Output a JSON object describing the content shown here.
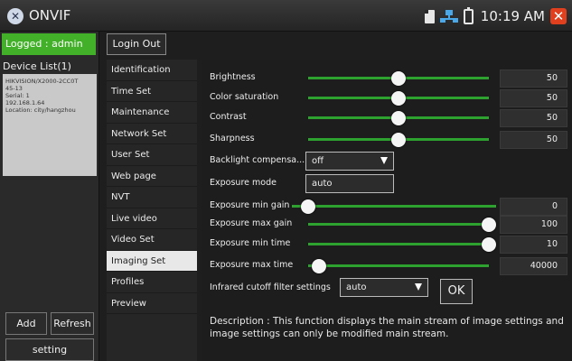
{
  "titlebar": {
    "app_name": "ONVIF",
    "time": "10:19 AM"
  },
  "left": {
    "logged": "Logged : admin",
    "device_list_title": "Device List(1)",
    "device": {
      "name": "HIKVISION/X2000-2CC0T",
      "line2": "45-13",
      "serial": "Serial: 1",
      "ip": "192.168.1.64",
      "location": "Location: city/hangzhou"
    },
    "add": "Add",
    "refresh": "Refresh",
    "setting": "setting"
  },
  "login_out": "Login Out",
  "menu": {
    "items": [
      {
        "label": "Identification",
        "active": false
      },
      {
        "label": "Time Set",
        "active": false
      },
      {
        "label": "Maintenance",
        "active": false
      },
      {
        "label": "Network Set",
        "active": false
      },
      {
        "label": "User Set",
        "active": false
      },
      {
        "label": "Web page",
        "active": false
      },
      {
        "label": "NVT",
        "active": false
      },
      {
        "label": "Live video",
        "active": false
      },
      {
        "label": "Video Set",
        "active": false
      },
      {
        "label": "Imaging Set",
        "active": true
      },
      {
        "label": "Profiles",
        "active": false
      },
      {
        "label": "Preview",
        "active": false
      }
    ]
  },
  "imaging": {
    "brightness": {
      "label": "Brightness",
      "value": "50",
      "level": 0.5
    },
    "saturation": {
      "label": "Color saturation",
      "value": "50",
      "level": 0.5
    },
    "contrast": {
      "label": "Contrast",
      "value": "50",
      "level": 0.5
    },
    "sharpness": {
      "label": "Sharpness",
      "value": "50",
      "level": 0.5
    },
    "backlight": {
      "label": "Backlight compensa...",
      "value": "off"
    },
    "exposure_mode": {
      "label": "Exposure mode",
      "value": "auto"
    },
    "exp_min_gain": {
      "label": "Exposure min gain",
      "value": "0",
      "level": 0.0
    },
    "exp_max_gain": {
      "label": "Exposure max gain",
      "value": "100",
      "level": 1.0
    },
    "exp_min_time": {
      "label": "Exposure min time",
      "value": "10",
      "level": 1.0
    },
    "exp_max_time": {
      "label": "Exposure max time",
      "value": "40000",
      "level": 0.06
    },
    "ir_cutoff": {
      "label": "Infrared cutoff filter settings",
      "value": "auto"
    },
    "ok": "OK",
    "description": "Description : This function displays the main stream of image settings and image settings can only be modified main stream."
  }
}
